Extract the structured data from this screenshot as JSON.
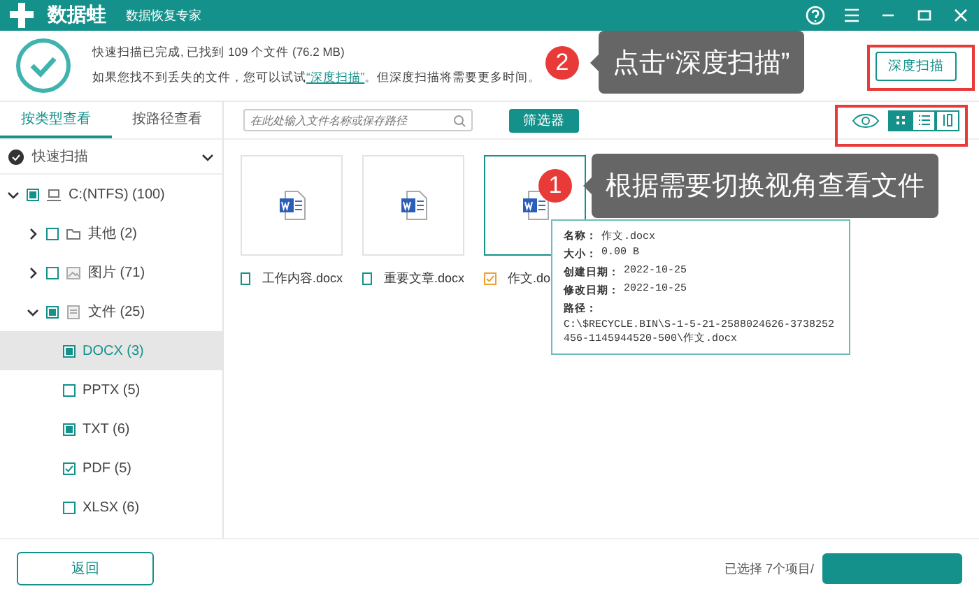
{
  "title_bar": {
    "app_name": "数据蛙",
    "subtitle": "数据恢复专家"
  },
  "scan_summary": {
    "status": "快速扫描已完成, 已找到 109 个文件 (76.2 MB)",
    "hint_before": "如果您找不到丢失的文件，您可以试试",
    "hint_link": "“深度扫描”",
    "hint_after": "。但深度扫描将需要更多时间。",
    "deep_scan_button": "深度扫描"
  },
  "sidebar": {
    "tabs": [
      {
        "label": "按类型查看",
        "selected": true
      },
      {
        "label": "按路径查看",
        "selected": false
      }
    ],
    "scan_mode": "快速扫描",
    "tree": [
      {
        "label": "C:(NTFS) (100)",
        "kind": "drive",
        "checked": false,
        "partial": true,
        "expanded": true,
        "selected": false,
        "children": [
          {
            "label": "其他 (2)",
            "kind": "folder",
            "checked": false,
            "partial": false,
            "expanded": false,
            "selected": false
          },
          {
            "label": "图片 (71)",
            "kind": "image",
            "checked": false,
            "partial": false,
            "expanded": false,
            "selected": false
          },
          {
            "label": "文件 (25)",
            "kind": "document",
            "checked": false,
            "partial": true,
            "expanded": true,
            "selected": false,
            "children": [
              {
                "label": "DOCX (3)",
                "kind": "type",
                "checked": false,
                "partial": true,
                "selected": true
              },
              {
                "label": "PPTX (5)",
                "kind": "type",
                "checked": false,
                "partial": false,
                "selected": false
              },
              {
                "label": "TXT (6)",
                "kind": "type",
                "checked": false,
                "partial": true,
                "selected": false
              },
              {
                "label": "PDF (5)",
                "kind": "type",
                "checked": true,
                "partial": false,
                "selected": false
              },
              {
                "label": "XLSX (6)",
                "kind": "type",
                "checked": false,
                "partial": false,
                "selected": false
              }
            ]
          }
        ]
      }
    ]
  },
  "toolbar": {
    "search": {
      "placeholder": "在此处输入文件名称或保存路径"
    },
    "filter_button": "筛选器",
    "views": [
      {
        "kind": "preview",
        "selected": false
      },
      {
        "kind": "grid",
        "selected": true
      },
      {
        "kind": "list",
        "selected": false
      },
      {
        "kind": "detail",
        "selected": false
      }
    ]
  },
  "files": [
    {
      "name": "工作内容.docx",
      "checked": false,
      "selected": false
    },
    {
      "name": "重要文章.docx",
      "checked": false,
      "selected": false
    },
    {
      "name": "作文.do",
      "checked": true,
      "selected": true
    }
  ],
  "file_info": [
    {
      "label": "名称：",
      "value": "作文.docx"
    },
    {
      "label": "大小：",
      "value": "0.00 B"
    },
    {
      "label": "创建日期：",
      "value": "2022-10-25"
    },
    {
      "label": "修改日期：",
      "value": "2022-10-25"
    },
    {
      "label": "路径：",
      "value": "C:\\$RECYCLE.BIN\\S-1-5-21-2588024626-3738252456-1145944520-500\\作文.docx"
    }
  ],
  "annotations": [
    {
      "number": "2",
      "text": "点击“深度扫描”"
    },
    {
      "number": "1",
      "text": "根据需要切换视角查看文件"
    }
  ],
  "footer": {
    "back_button": "返回",
    "selection": "已选择 7个项目/"
  }
}
